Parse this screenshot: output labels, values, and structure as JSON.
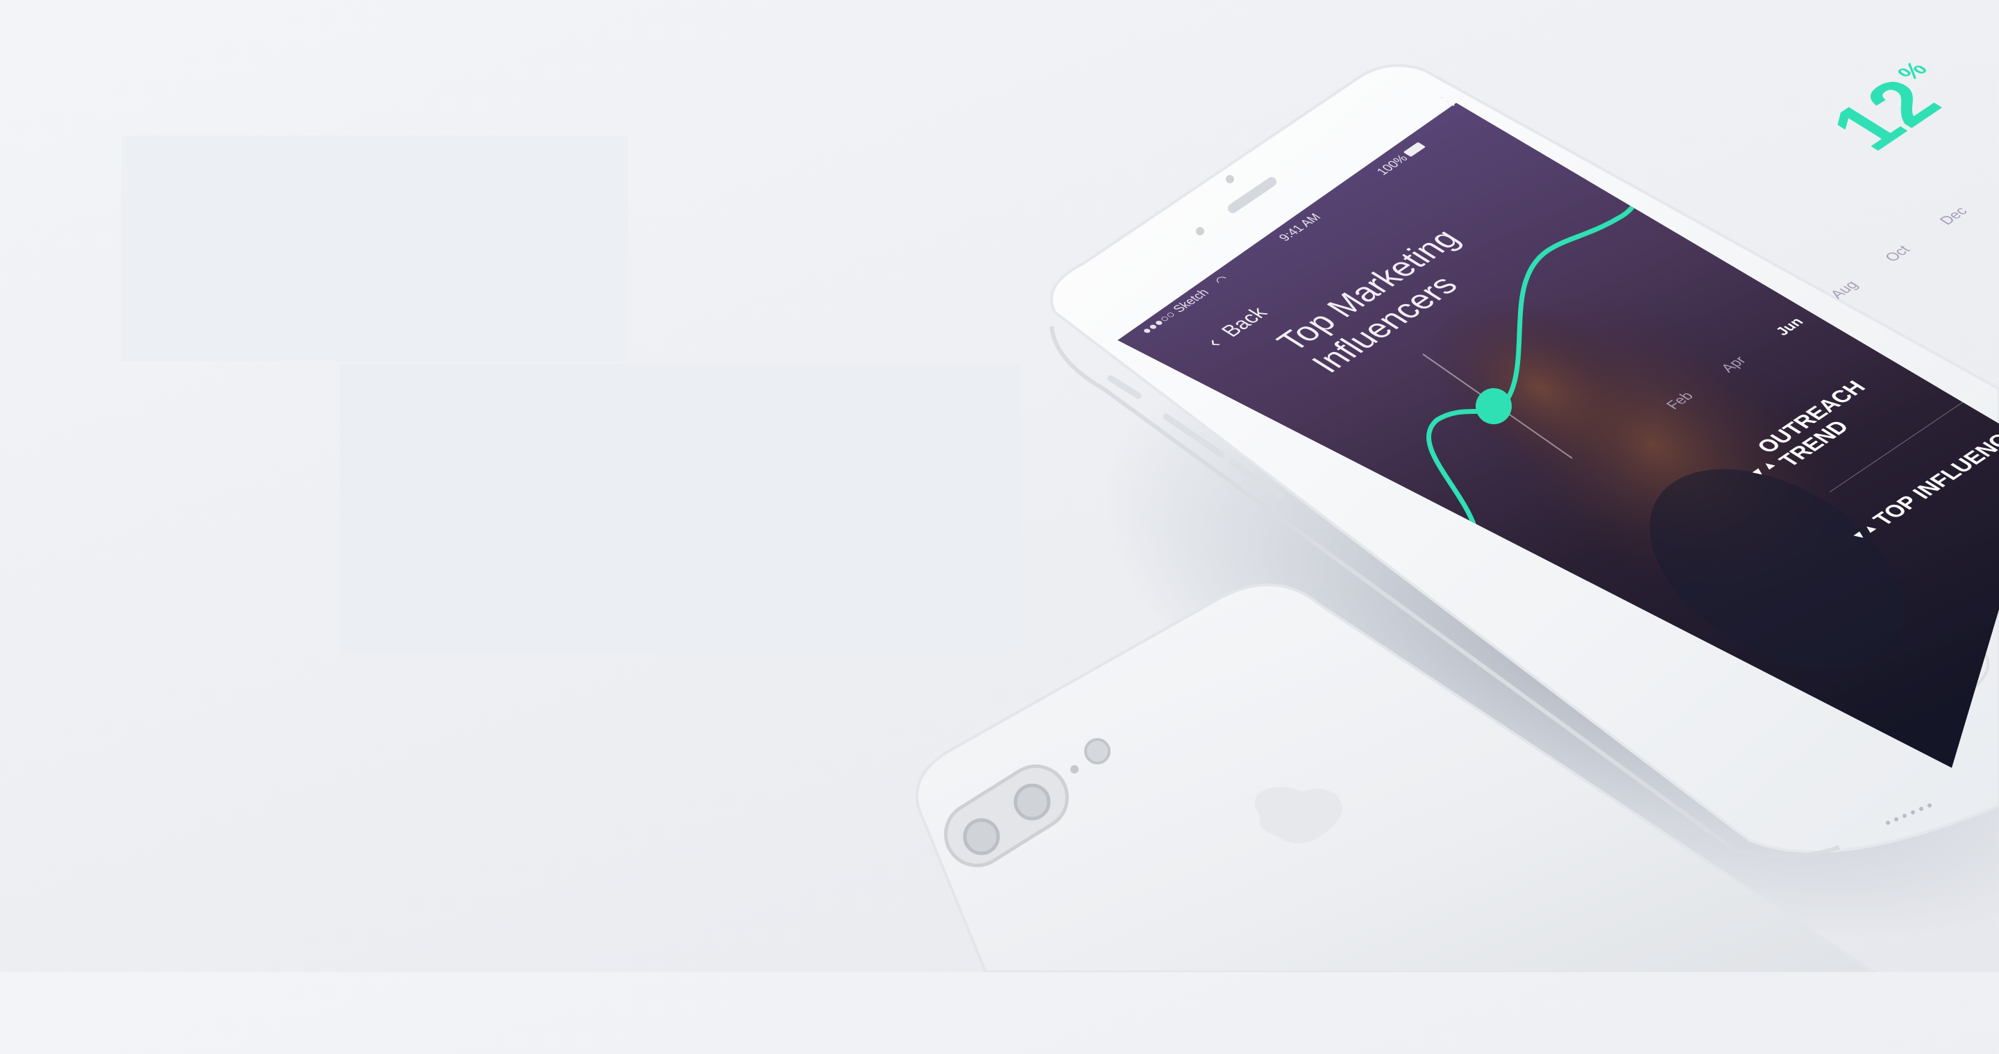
{
  "status_bar": {
    "carrier": "●●●○○ Sketch",
    "time": "9:41 AM",
    "battery": "100%"
  },
  "nav": {
    "back_label": "Back",
    "back_icon": "chevron-left-icon",
    "more_icon": "more-dots-icon"
  },
  "screen": {
    "title_line1": "Top Marketing",
    "title_line2": "Influencers",
    "stat_value": "12",
    "stat_unit": "%",
    "section1_line1": "OUTREACH",
    "section1_line2": "TREND",
    "section2": "TOP INFLUENCERS",
    "section_icon": "triangles-icon"
  },
  "chart_data": {
    "type": "line",
    "x": [
      "Feb",
      "Apr",
      "Jun",
      "Aug",
      "Oct",
      "Dec"
    ],
    "selected": "Jun",
    "accent_color": "#2fe0b4"
  },
  "colors": {
    "screen_top": "#5b4a7c",
    "screen_bottom": "#17162a",
    "accent": "#2fe0b4"
  }
}
